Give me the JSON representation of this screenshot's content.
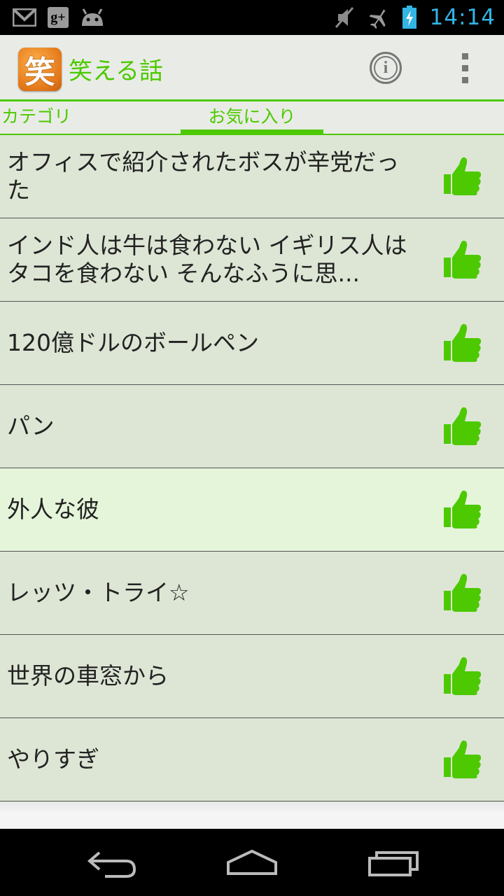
{
  "status_bar": {
    "time": "14:14",
    "left_icons": [
      "gmail-icon",
      "google-plus-icon",
      "android-icon"
    ],
    "gplus_label": "g+",
    "right_icons": [
      "mute-icon",
      "airplane-icon",
      "battery-charging-icon"
    ]
  },
  "action_bar": {
    "app_icon_label": "笑",
    "title": "笑える話",
    "info_icon": "ⓘ"
  },
  "tabs": [
    {
      "label": "カテゴリ",
      "selected": false
    },
    {
      "label": "お気に入り",
      "selected": true
    }
  ],
  "items": [
    {
      "title": "オフィスで紹介されたボスが辛党だった"
    },
    {
      "title": "インド人は牛は食わない イギリス人はタコを食わない そんなふうに思..."
    },
    {
      "title": "120億ドルのボールペン"
    },
    {
      "title": "パン"
    },
    {
      "title": "外人な彼",
      "selected": true
    },
    {
      "title": "レッツ・トライ☆"
    },
    {
      "title": "世界の車窓から"
    },
    {
      "title": "やりすぎ"
    }
  ],
  "colors": {
    "accent": "#4cc900",
    "list_bg": "#dde6d5",
    "selected_bg": "#e5f5da",
    "thumb": "#4cc900"
  }
}
